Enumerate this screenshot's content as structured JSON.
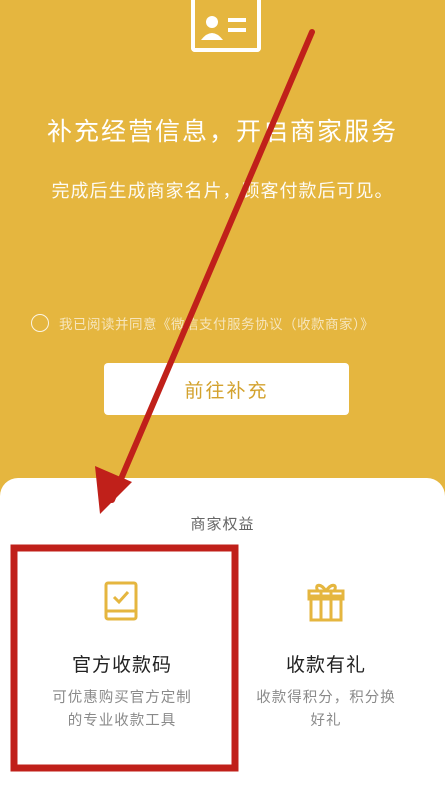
{
  "header": {
    "title": "补充经营信息，开启商家服务",
    "subtitle": "完成后生成商家名片，顾客付款后可见。"
  },
  "agreement": {
    "prefix": "我已阅读并同意",
    "link": "《微信支付服务协议（收款商家）》",
    "checked": false
  },
  "actions": {
    "go_label": "前往补充"
  },
  "benefits": {
    "title": "商家权益",
    "items": [
      {
        "title": "官方收款码",
        "desc_line1": "可优惠购买官方定制",
        "desc_line2": "的专业收款工具",
        "icon": "qr-code-book-icon"
      },
      {
        "title": "收款有礼",
        "desc_line1": "收款得积分，积分换",
        "desc_line2": "好礼",
        "icon": "gift-icon"
      }
    ]
  },
  "colors": {
    "background": "#E5B63F",
    "accent": "#D3A22E",
    "annotation_red": "#C0201A"
  }
}
